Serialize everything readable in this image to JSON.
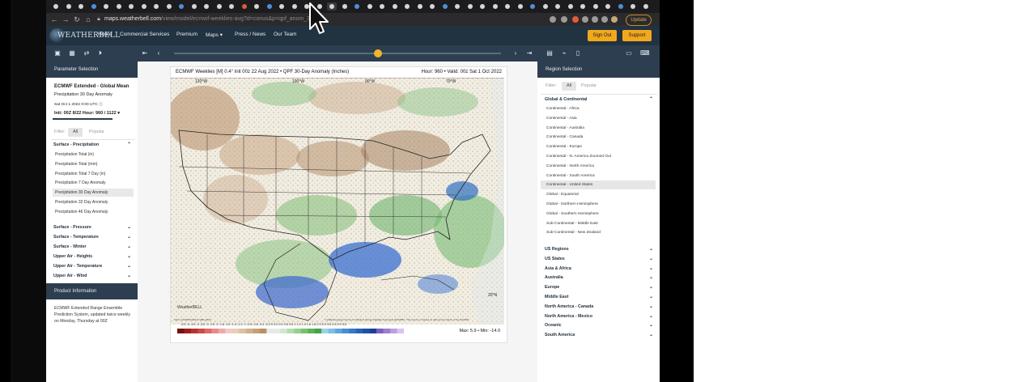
{
  "browser": {
    "url_host": "maps.weatherbell.com",
    "url_path": "/view/model/ecmwf-weeklies-avg?d=conus&p=qpf_anom_30day",
    "update_label": "Update"
  },
  "site": {
    "logo_text": "WEATHERBELL",
    "nav": [
      "Home",
      "Commercial Services",
      "Premium",
      "Maps",
      "Press / News",
      "Our Team"
    ],
    "sign_out": "Sign Out",
    "support": "Support"
  },
  "left_panel": {
    "header": "Parameter Selection",
    "model_title": "ECMWF Extended - Global Mean",
    "product": "Precipitation 30 Day Anomaly",
    "date": "Sat Oct 1 2022 0:00 UTC",
    "init": "Init: 00Z 8/22  Hour: 960 / 1122",
    "filter_label": "Filter:",
    "filter_all": "All",
    "filter_popular": "Popular",
    "group_open": "Surface - Precipitation",
    "items": [
      "Precipitation Total (in)",
      "Precipitation Total (mm)",
      "Precipitation Total 7 Day (in)",
      "Precipitation 7 Day Anomaly",
      "Precipitation 30 Day Anomaly",
      "Precipitation 32 Day Anomaly",
      "Precipitation 46 Day Anomaly"
    ],
    "groups": [
      "Surface - Pressure",
      "Surface - Temperature",
      "Surface - Winter",
      "Upper Air - Heights",
      "Upper Air - Temperature",
      "Upper Air - Wind"
    ],
    "product_info_header": "Product Information",
    "product_info_text": "ECMWF Extended Range Ensemble Prediction System, updated twice weekly on Monday, Thursday at 00Z"
  },
  "map": {
    "title_left": "ECMWF Weeklies [M] 0.4° Init 00z 22 Aug 2022 • QPF 30-Day Anomaly (Inches)",
    "title_right": "Hour: 960 • Valid: 00z Sat 1 Oct 2022",
    "colorbar_labels": "-5.5 -5 -4.5 -4 -3.5 -3 -2.5 -2 -1.8 -1.6 -1.4 -1.2 -1 -0.8 -0.6 -0.4 -0.2 0 0.2 0.4 0.6 0.8 1 1.2 1.4 1.6 1.8 2 2.5 3 3.5 4 4.5 5 5.5",
    "max_min": "Max: 5.9 • Min: -14.0",
    "credit": "© 2022 European Centre for Medium-Range Weather Forecasts (ECMWF). This service is based on data and products of the ECMWF.",
    "brand": "WeatherBELL",
    "climo": "Climo: ECMWF ERA-5 1991-2020"
  },
  "right_panel": {
    "header": "Region Selection",
    "filter_label": "Filter:",
    "filter_all": "All",
    "filter_popular": "Popular",
    "group_open": "Global & Continental",
    "items": [
      "Continental - Africa",
      "Continental - Asia",
      "Continental - Australia",
      "Continental - Canada",
      "Continental - Europe",
      "Continental - N. America Zoomed Out",
      "Continental - North America",
      "Continental - South America",
      "Continental - United States",
      "Global - Equatorial",
      "Global - Northern Hemisphere",
      "Global - Southern Hemisphere",
      "Sub-Continental - Middle East",
      "Sub-Continental - New Zealand"
    ],
    "groups": [
      "US Regions",
      "US States",
      "Asia & Africa",
      "Australia",
      "Europe",
      "Middle East",
      "North America - Canada",
      "North America - Mexico",
      "Oceanic",
      "South America"
    ]
  },
  "colors": {
    "header_bg": "#213241",
    "toolbar_bg": "#2c3e4f",
    "accent": "#f2a81d"
  }
}
